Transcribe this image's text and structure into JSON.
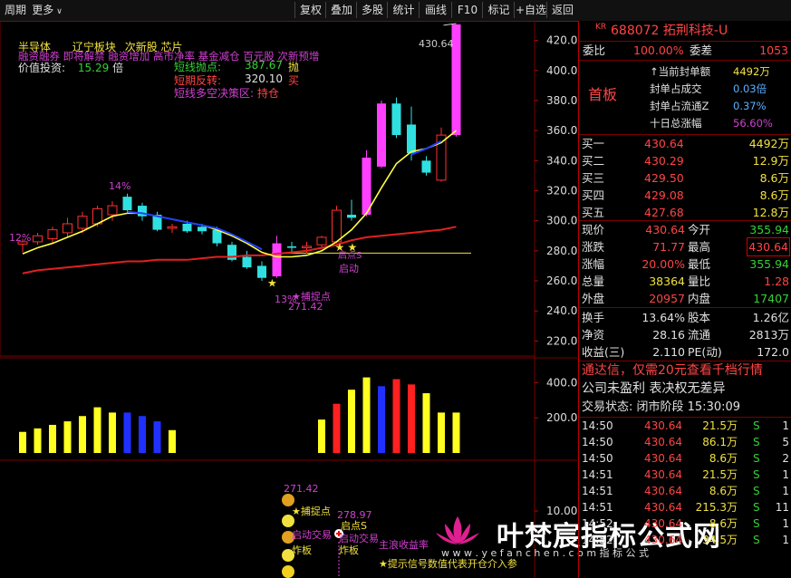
{
  "toolbar": {
    "period": "周期",
    "more": "更多",
    "buttons": [
      "复权",
      "叠加",
      "多股",
      "统计",
      "画线",
      "F10",
      "标记",
      "+自选",
      "返回"
    ]
  },
  "header": {
    "market": "KR",
    "code_name": "688072 拓荆科技-U"
  },
  "chart_data": {
    "type": "candlestick",
    "main_yticks": [
      220,
      240,
      260,
      280,
      300,
      320,
      340,
      360,
      380,
      400,
      420
    ],
    "ylim": [
      210,
      433
    ],
    "candles": [
      {
        "o": 284.5,
        "h": 288,
        "l": 279,
        "c": 286
      },
      {
        "o": 286,
        "h": 292,
        "l": 284,
        "c": 290
      },
      {
        "o": 288,
        "h": 296,
        "l": 285,
        "c": 294
      },
      {
        "o": 292,
        "h": 302,
        "l": 289,
        "c": 298
      },
      {
        "o": 295,
        "h": 306,
        "l": 292,
        "c": 303
      },
      {
        "o": 298,
        "h": 310,
        "l": 296,
        "c": 308
      },
      {
        "o": 304,
        "h": 313,
        "l": 300,
        "c": 310
      },
      {
        "o": 316,
        "h": 318,
        "l": 305,
        "c": 307
      },
      {
        "o": 310,
        "h": 312,
        "l": 300,
        "c": 303
      },
      {
        "o": 304,
        "h": 306,
        "l": 293,
        "c": 294
      },
      {
        "o": 295,
        "h": 298,
        "l": 292,
        "c": 296
      },
      {
        "o": 298,
        "h": 300,
        "l": 292,
        "c": 293
      },
      {
        "o": 296,
        "h": 298,
        "l": 291,
        "c": 293
      },
      {
        "o": 294,
        "h": 296,
        "l": 283,
        "c": 285
      },
      {
        "o": 284,
        "h": 286,
        "l": 273,
        "c": 274
      },
      {
        "o": 276,
        "h": 280,
        "l": 268,
        "c": 269
      },
      {
        "o": 270,
        "h": 273,
        "l": 260,
        "c": 262
      },
      {
        "o": 263,
        "h": 290,
        "l": 262,
        "c": 285
      },
      {
        "o": 283,
        "h": 286,
        "l": 279,
        "c": 282
      },
      {
        "o": 282,
        "h": 286,
        "l": 278,
        "c": 283
      },
      {
        "o": 284,
        "h": 290,
        "l": 281,
        "c": 289
      },
      {
        "o": 286,
        "h": 310,
        "l": 285,
        "c": 307
      },
      {
        "o": 304,
        "h": 314,
        "l": 300,
        "c": 302
      },
      {
        "o": 304,
        "h": 347,
        "l": 303,
        "c": 342
      },
      {
        "o": 336,
        "h": 380,
        "l": 335,
        "c": 378
      },
      {
        "o": 378,
        "h": 382,
        "l": 355,
        "c": 357
      },
      {
        "o": 364,
        "h": 376,
        "l": 340,
        "c": 345
      },
      {
        "o": 340,
        "h": 343,
        "l": 330,
        "c": 332
      },
      {
        "o": 327,
        "h": 362,
        "l": 326,
        "c": 357
      },
      {
        "o": 357,
        "h": 430.64,
        "l": 356,
        "c": 430.64
      }
    ],
    "ma_yellow": [
      278,
      282,
      285,
      289,
      293,
      298,
      303,
      305,
      305,
      303,
      301,
      299,
      297,
      294,
      290,
      285,
      279,
      276,
      276,
      277,
      280,
      286,
      294,
      305,
      322,
      338,
      346,
      348,
      352,
      360
    ],
    "ma_blue": [
      null,
      null,
      null,
      null,
      null,
      null,
      null,
      306,
      305,
      303,
      301,
      299,
      297,
      295,
      291,
      286,
      281,
      null,
      null,
      null,
      null,
      null,
      null,
      null,
      null,
      null,
      344,
      348,
      353,
      null
    ],
    "ma_red": [
      265,
      267,
      268,
      269,
      270,
      271,
      272,
      273,
      273,
      274,
      274,
      274,
      275,
      276,
      276,
      277,
      277,
      278,
      279,
      280,
      282,
      284,
      287,
      289,
      290,
      291,
      292,
      293,
      294,
      296
    ],
    "vol_yticks": [
      200,
      400
    ],
    "volumes": [
      {
        "v": 120,
        "col": "yellow"
      },
      {
        "v": 140,
        "col": "yellow"
      },
      {
        "v": 160,
        "col": "yellow"
      },
      {
        "v": 180,
        "col": "yellow"
      },
      {
        "v": 210,
        "col": "yellow"
      },
      {
        "v": 260,
        "col": "yellow"
      },
      {
        "v": 230,
        "col": "yellow"
      },
      {
        "v": 230,
        "col": "blue"
      },
      {
        "v": 210,
        "col": "blue"
      },
      {
        "v": 180,
        "col": "blue"
      },
      {
        "v": 130,
        "col": "yellow"
      },
      null,
      null,
      null,
      null,
      null,
      null,
      null,
      null,
      null,
      {
        "v": 190,
        "col": "yellow"
      },
      {
        "v": 280,
        "col": "red"
      },
      {
        "v": 360,
        "col": "yellow"
      },
      {
        "v": 430,
        "col": "yellow"
      },
      {
        "v": 380,
        "col": "blue"
      },
      {
        "v": 420,
        "col": "red"
      },
      {
        "v": 390,
        "col": "red"
      },
      {
        "v": 340,
        "col": "yellow"
      },
      {
        "v": 230,
        "col": "yellow"
      },
      {
        "v": 230,
        "col": "yellow"
      }
    ],
    "ind_ytick": "10.00"
  },
  "overlays": {
    "line1": [
      "半导体",
      "辽宁板块",
      "次新股",
      "芯片"
    ],
    "line2": "融资融券 即将解禁 融资增加 高市净率 基金减仓 百元股 次新预增",
    "value_label": "价值投资:",
    "value_num": "15.29",
    "value_unit": "倍",
    "box1_label": "短线抛点:",
    "box1_val": "387.67",
    "box1_tag": "抛",
    "box2_label": "短期反转:",
    "box2_val": "320.10",
    "box2_tag": "买",
    "box3_label": "短线多空决策区:",
    "box3_tag": "持仓",
    "pct_14": "14%",
    "pct_12": "12%",
    "pct_13": "13%",
    "peak_label": "430.64",
    "low_label": "271.42",
    "catch_label": "★捕捉点",
    "launch_label": "启动",
    "launch_s": "启点S",
    "ind_label1": "271.42",
    "ind_label2": "★捕捉点",
    "ind_label3": "启动交易",
    "ind_label4": "炸板",
    "ind_label5": "278.97",
    "ind_label6": "启点S",
    "ind_label7": "启动交易",
    "ind_label8": "炸板",
    "ind_label9": "主浪收益率",
    "ind_note": "★提示信号数值代表开仓介入参",
    "watermark": "叶梵宸指标公式网",
    "watermark_url": "w w w . y e f a n c h e n . c o m   指 标 公 式"
  },
  "panel": {
    "weibi_label": "委比",
    "weibi_val": "100.00%",
    "weicha_label": "委差",
    "weicha_val": "1053",
    "seal_title": "首板",
    "seal_rows": [
      {
        "label": "↑当前封单额",
        "val": "4492万"
      },
      {
        "label": "封单占成交",
        "val": "0.03倍"
      },
      {
        "label": "封单占流通Z",
        "val": "0.37%"
      },
      {
        "label": "十日总涨幅",
        "val": "56.60%"
      }
    ],
    "buys": [
      {
        "label": "买一",
        "price": "430.64",
        "vol": "4492万"
      },
      {
        "label": "买二",
        "price": "430.29",
        "vol": "12.9万"
      },
      {
        "label": "买三",
        "price": "429.50",
        "vol": "8.6万"
      },
      {
        "label": "买四",
        "price": "429.08",
        "vol": "8.6万"
      },
      {
        "label": "买五",
        "price": "427.68",
        "vol": "12.8万"
      }
    ],
    "quote": [
      {
        "l1": "现价",
        "v1": "430.64",
        "l2": "今开",
        "v2": "355.94"
      },
      {
        "l1": "涨跌",
        "v1": "71.77",
        "l2": "最高",
        "v2": "430.64"
      },
      {
        "l1": "涨幅",
        "v1": "20.00%",
        "l2": "最低",
        "v2": "355.94"
      },
      {
        "l1": "总量",
        "v1": "38364",
        "l2": "量比",
        "v2": "1.28"
      },
      {
        "l1": "外盘",
        "v1": "20957",
        "l2": "内盘",
        "v2": "17407"
      }
    ],
    "fin": [
      {
        "l1": "换手",
        "v1": "13.64%",
        "l2": "股本",
        "v2": "1.26亿"
      },
      {
        "l1": "净资",
        "v1": "28.16",
        "l2": "流通",
        "v2": "2813万"
      },
      {
        "l1": "收益(三)",
        "v1": "2.110",
        "l2": "PE(动)",
        "v2": "172.0"
      }
    ],
    "promo": "通达信，仅需20元查看千档行情",
    "notice": "公司未盈利 表决权无差异",
    "status": "交易状态: 闭市阶段 15:30:09",
    "ticks": [
      {
        "t": "14:50",
        "p": "430.64",
        "v": "21.5万",
        "s": "S",
        "n": "1"
      },
      {
        "t": "14:50",
        "p": "430.64",
        "v": "86.1万",
        "s": "S",
        "n": "5"
      },
      {
        "t": "14:50",
        "p": "430.64",
        "v": "8.6万",
        "s": "S",
        "n": "2"
      },
      {
        "t": "14:51",
        "p": "430.64",
        "v": "21.5万",
        "s": "S",
        "n": "1"
      },
      {
        "t": "14:51",
        "p": "430.64",
        "v": "8.6万",
        "s": "S",
        "n": "1"
      },
      {
        "t": "14:51",
        "p": "430.64",
        "v": "215.3万",
        "s": "S",
        "n": "11"
      },
      {
        "t": "14:52",
        "p": "430.64",
        "v": "8.6万",
        "s": "S",
        "n": "1"
      },
      {
        "t": "14:52",
        "p": "430.64",
        "v": "34.5万",
        "s": "S",
        "n": "1"
      }
    ]
  }
}
